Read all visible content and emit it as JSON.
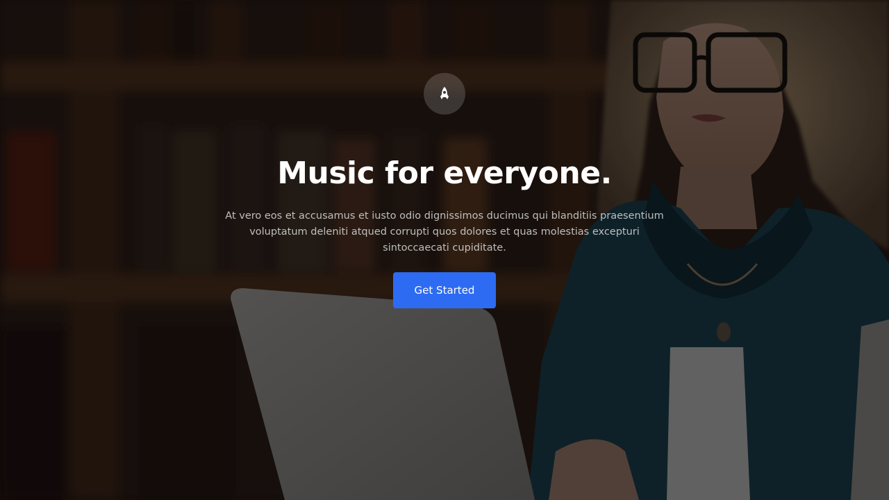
{
  "hero": {
    "icon": "rocket-icon",
    "title": "Music for everyone.",
    "description": "At vero eos et accusamus et iusto odio dignissimos ducimus qui blanditiis praesentium voluptatum deleniti atqued corrupti quos dolores et quas molestias excepturi sintoccaecati cupiditate.",
    "cta_label": "Get Started"
  },
  "colors": {
    "overlay": "#000000",
    "cta_background": "#2c6bf2",
    "title_text": "#ffffff",
    "description_text": "#e6e6e6"
  }
}
